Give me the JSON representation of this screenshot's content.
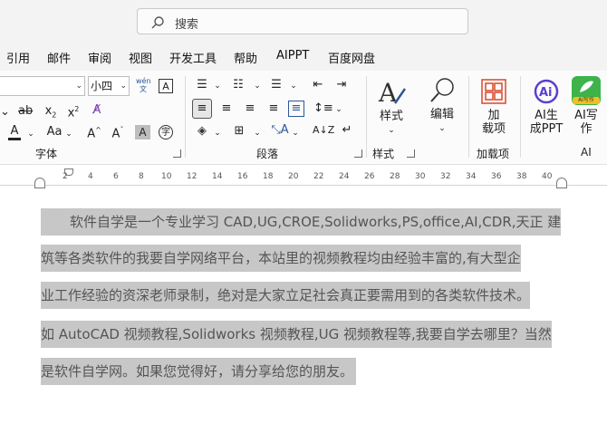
{
  "search": {
    "placeholder": "搜索"
  },
  "menu": [
    "引用",
    "邮件",
    "审阅",
    "视图",
    "开发工具",
    "帮助",
    "AIPPT",
    "百度网盘"
  ],
  "font": {
    "size": "小四",
    "phonetic_top": "wén",
    "phonetic_bottom": "文"
  },
  "groups": {
    "font_label": "字体",
    "paragraph_label": "段落",
    "styles_label": "样式",
    "addins_label": "加载项",
    "ai_label": "AI"
  },
  "buttons": {
    "styles": "样式",
    "edit": "编辑",
    "addins_line1": "加",
    "addins_line2": "载项",
    "ai_ppt_line1": "AI生",
    "ai_ppt_line2": "成PPT",
    "ai_write_line1": "AI写",
    "ai_write_line2": "作",
    "ai_write_badge": "AI写作"
  },
  "ruler": [
    "2",
    "4",
    "6",
    "8",
    "10",
    "12",
    "14",
    "16",
    "18",
    "20",
    "22",
    "24",
    "26",
    "28",
    "30",
    "32",
    "34",
    "36",
    "38",
    "40"
  ],
  "document": {
    "lines": [
      "软件自学是一个专业学习 CAD,UG,CROE,Solidworks,PS,office,AI,CDR,天正 建",
      "筑等各类软件的我要自学网络平台，本站里的视频教程均由经验丰富的,有大型企",
      "业工作经验的资深老师录制，绝对是大家立足社会真正要需用到的各类软件技术。",
      "如 AutoCAD 视频教程,Solidworks 视频教程,UG 视频教程等,我要自学去哪里？当然",
      "是软件自学网。如果您觉得好，请分享给您的朋友。"
    ]
  },
  "colors": {
    "selection": "#c7c7c7",
    "ribbon_bg": "#fbfbfb",
    "accent": "#2b579a",
    "addins_icon": "#d9472b"
  }
}
